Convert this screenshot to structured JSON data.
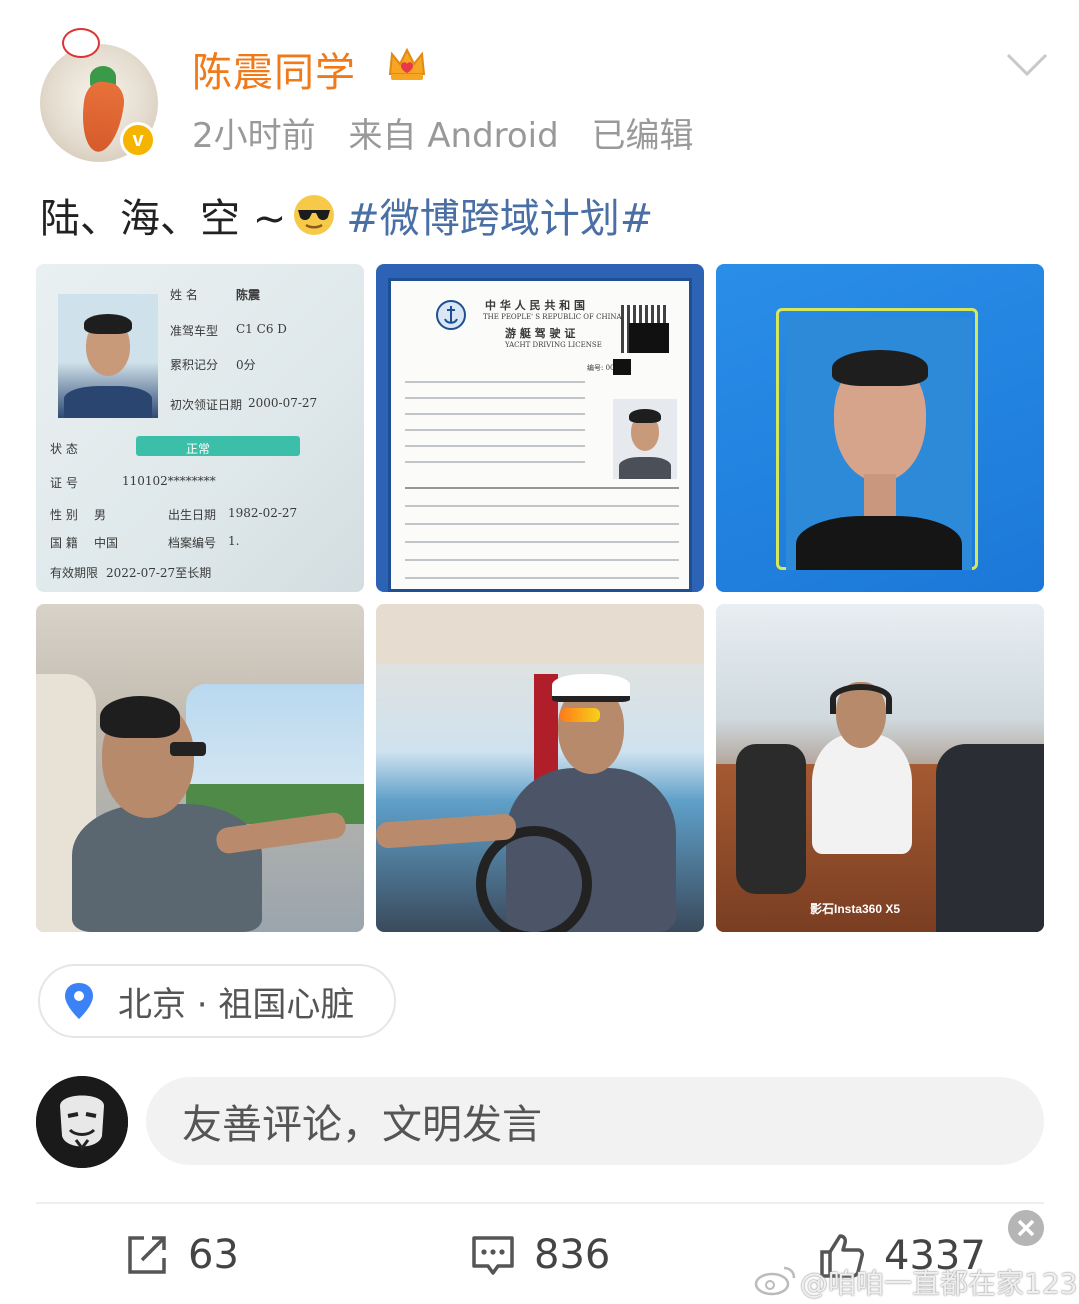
{
  "post": {
    "username": "陈震同学",
    "time": "2小时前",
    "source": "来自 Android",
    "edited": "已编辑",
    "text_prefix": "陆、海、空 ~",
    "hashtag": "#微博跨域计划#"
  },
  "images": {
    "license": {
      "name_label": "姓 名",
      "name_value": "陈震",
      "class_label": "准驾车型",
      "class_value": "C1 C6 D",
      "points_label": "累积记分",
      "points_value": "0分",
      "first_label": "初次领证日期",
      "first_value": "2000-07-27",
      "status_label": "状 态",
      "status_value": "正常",
      "id_label": "证 号",
      "id_value": "110102********",
      "sex_label": "性 别",
      "sex_value": "男",
      "birth_label": "出生日期",
      "birth_value": "1982-02-27",
      "nation_label": "国 籍",
      "nation_value": "中国",
      "file_label": "档案编号",
      "file_value": "1.",
      "valid_label": "有效期限",
      "valid_value": "2022-07-27至长期"
    },
    "yacht": {
      "title_cn": "中 华 人 民 共 和 国",
      "title_en": "THE PEOPLE' S REPUBLIC OF CHINA",
      "doc_cn": "游 艇 驾 驶 证",
      "doc_en": "YACHT DRIVING LICENSE",
      "number_label": "编号: 00"
    },
    "flight_watermark": "影石Insta360 X5"
  },
  "location": {
    "text": "北京 · 祖国心脏"
  },
  "comment": {
    "placeholder": "友善评论，文明发言"
  },
  "actions": {
    "shares": "63",
    "comments": "836",
    "likes": "4337"
  },
  "watermark": {
    "text": "@咱咱一直都在家123"
  },
  "colors": {
    "username": "#f07a19",
    "hashtag": "#4a6fa5",
    "verify": "#f5b400",
    "pin": "#3b82f6"
  }
}
